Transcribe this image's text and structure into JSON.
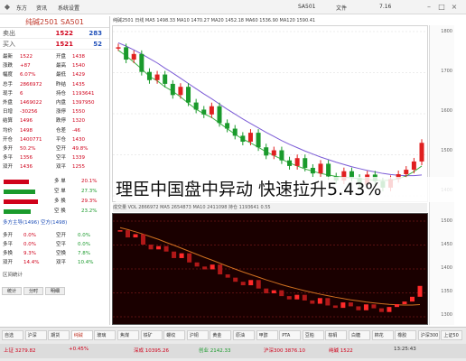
{
  "headline": "理臣中国盘中异动 快速拉升5.43%",
  "titlebar": {
    "tabs": [
      "东方",
      "资讯",
      "系统设置",
      "SA501",
      "文件"
    ],
    "code": "SA501",
    "price_label": "7.16"
  },
  "quote": {
    "name": "纯碱2501 SA501",
    "sell_label": "卖出",
    "sell_price": "1522",
    "sell_vol": "283",
    "buy_label": "买入",
    "buy_price": "1521",
    "buy_vol": "52"
  },
  "quote_rows": [
    {
      "l1": "最新",
      "v1": "1522",
      "l2": "开盘",
      "v2": "1438"
    },
    {
      "l1": "涨跌",
      "v1": "+87",
      "l2": "最高",
      "v2": "1540"
    },
    {
      "l1": "幅度",
      "v1": "6.07%",
      "l2": "最低",
      "v2": "1429"
    },
    {
      "l1": "总手",
      "v1": "2866972",
      "l2": "昨结",
      "v2": "1435"
    },
    {
      "l1": "现手",
      "v1": "6",
      "l2": "持仓",
      "v2": "1193641"
    },
    {
      "l1": "外盘",
      "v1": "1469022",
      "l2": "内盘",
      "v2": "1397950"
    },
    {
      "l1": "日增",
      "v1": "-30256",
      "l2": "涨停",
      "v2": "1550"
    },
    {
      "l1": "结算",
      "v1": "1496",
      "l2": "跌停",
      "v2": "1320"
    },
    {
      "l1": "均价",
      "v1": "1498",
      "l2": "仓差",
      "v2": "-46"
    },
    {
      "l1": "开仓",
      "v1": "1400771",
      "l2": "平仓",
      "v2": "1430"
    },
    {
      "l1": "多开",
      "v1": "50.2%",
      "l2": "空开",
      "v2": "49.8%"
    },
    {
      "l1": "多平",
      "v1": "1356",
      "l2": "空平",
      "v2": "1339"
    },
    {
      "l1": "双开",
      "v1": "1436",
      "l2": "双平",
      "v2": "1255"
    }
  ],
  "flow_rows": [
    {
      "label": "多 单",
      "pct": "20.1%",
      "color": "#d0021b",
      "fill": 0.55
    },
    {
      "label": "空 单",
      "pct": "27.3%",
      "color": "#1a9a2c",
      "fill": 0.7
    },
    {
      "label": "多 换",
      "pct": "29.3%",
      "color": "#d0021b",
      "fill": 0.75
    },
    {
      "label": "空 换",
      "pct": "23.2%",
      "color": "#1a9a2c",
      "fill": 0.6
    }
  ],
  "flow_summary": "多方主导(1496)  空方(1498)",
  "ratio_rows": [
    {
      "a": "多开",
      "av": "0.0%",
      "b": "空开",
      "bv": "0.0%"
    },
    {
      "a": "多平",
      "av": "0.0%",
      "b": "空平",
      "bv": "0.0%"
    },
    {
      "a": "多换",
      "av": "9.3%",
      "b": "空换",
      "bv": "7.8%"
    },
    {
      "a": "双开",
      "av": "14.4%",
      "b": "双平",
      "bv": "10.4%"
    }
  ],
  "left_tabs": [
    "统计",
    "分时",
    "明细"
  ],
  "stats_label": "区间统计",
  "chart_header": "纯碱2501 日线 MA5 1498.33  MA10 1470.27  MA20 1452.18  MA60 1536.90  MA120 1590.41",
  "strip_text": "成交量 VOL 2866972  MA5 2654873  MA10 2411098  持仓 1193641  0.55",
  "axis_top": [
    "1800",
    "1700",
    "1600",
    "1500",
    "1400"
  ],
  "axis_bot": [
    "1500",
    "1450",
    "1400",
    "1350",
    "1300"
  ],
  "bottom_tabs": [
    "自选",
    "沪深",
    "期货",
    "纯碱",
    "玻璃",
    "焦煤",
    "铁矿",
    "螺纹",
    "沪铜",
    "黄金",
    "原油",
    "甲醇",
    "PTA",
    "豆粕",
    "棕榈",
    "白糖",
    "棉花",
    "橡胶",
    "沪深300",
    "上证50"
  ],
  "status_items": [
    {
      "text": "上证 3279.82",
      "color": "#d0021b"
    },
    {
      "text": "+0.45%",
      "color": "#d0021b"
    },
    {
      "text": "深成 10395.26",
      "color": "#d0021b"
    },
    {
      "text": "创业 2142.33",
      "color": "#1a9a2c"
    },
    {
      "text": "沪深300 3876.10",
      "color": "#d0021b"
    },
    {
      "text": "纯碱 1522",
      "color": "#d0021b"
    },
    {
      "text": "13:25:43",
      "color": "#333333"
    }
  ],
  "chart_data": {
    "type": "line",
    "title": "纯碱2501",
    "candles": [
      1778,
      1745,
      1760,
      1712,
      1690,
      1705,
      1680,
      1650,
      1672,
      1630,
      1611,
      1598,
      1620,
      1575,
      1560,
      1541,
      1525,
      1549,
      1510,
      1488,
      1502,
      1475,
      1460,
      1481,
      1455,
      1440,
      1466,
      1432,
      1421,
      1446,
      1428,
      1410,
      1437,
      1419,
      1402,
      1425,
      1438,
      1450,
      1472,
      1522
    ],
    "ma_short": [
      1770,
      1755,
      1738,
      1720,
      1700,
      1688,
      1672,
      1660,
      1645,
      1628,
      1612,
      1600,
      1590,
      1575,
      1560,
      1545,
      1532,
      1522,
      1510,
      1498,
      1488,
      1478,
      1468,
      1460,
      1452,
      1446,
      1440,
      1436,
      1432,
      1430,
      1428,
      1426,
      1424,
      1422,
      1421,
      1422,
      1426,
      1433,
      1445,
      1460
    ],
    "ma_long": [
      1790,
      1781,
      1771,
      1760,
      1748,
      1736,
      1722,
      1709,
      1695,
      1681,
      1667,
      1653,
      1640,
      1626,
      1612,
      1599,
      1586,
      1574,
      1562,
      1550,
      1539,
      1528,
      1518,
      1509,
      1500,
      1492,
      1484,
      1477,
      1470,
      1464,
      1458,
      1453,
      1448,
      1444,
      1440,
      1437,
      1435,
      1434,
      1434,
      1436
    ],
    "ylim": [
      1380,
      1820
    ]
  }
}
